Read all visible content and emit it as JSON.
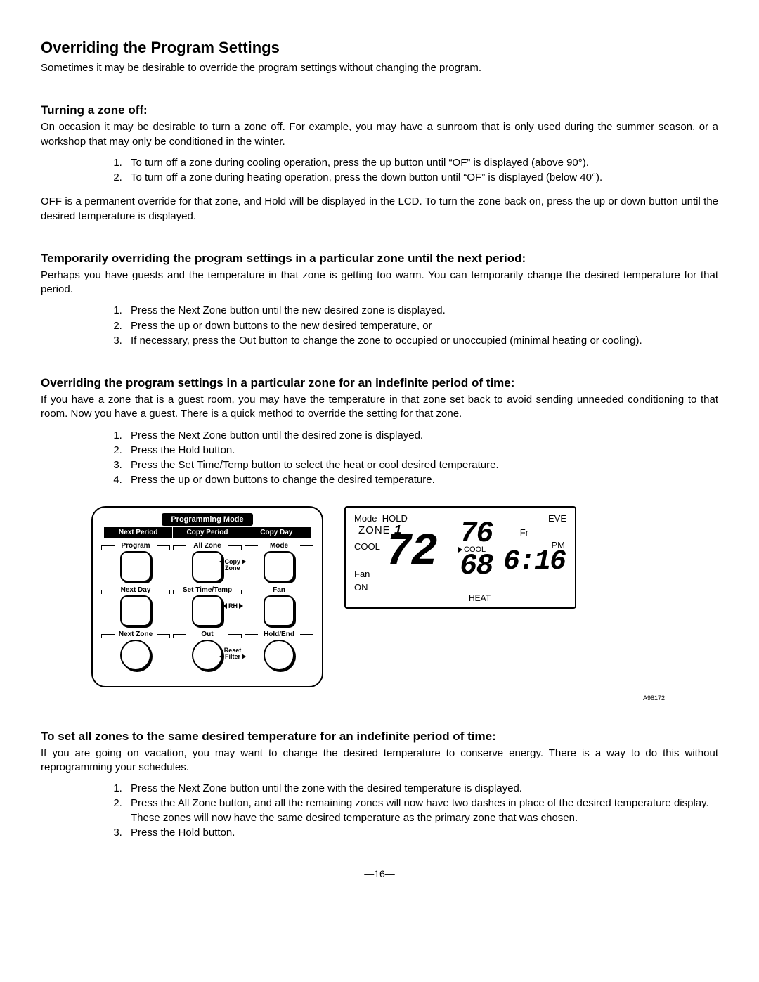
{
  "h1": "Overriding the Program Settings",
  "intro": "Sometimes it may be desirable to override the program settings without changing the program.",
  "s1": {
    "h": "Turning a zone off:",
    "p1": "On occasion it may be desirable to turn a zone off. For example, you may have a sunroom that is only used during the summer season, or a workshop that may only be conditioned in the winter.",
    "li1": "To turn off a zone during cooling operation, press the up button until “OF” is displayed (above 90°).",
    "li2": "To turn off a zone during heating operation, press the down button until “OF” is displayed (below 40°).",
    "p2": "OFF is a permanent override for that zone, and Hold will be displayed in the LCD. To turn the zone back on, press the up or down button until the desired temperature is displayed."
  },
  "s2": {
    "h": "Temporarily overriding the program settings in a particular zone until the next period:",
    "p": "Perhaps you have guests and the temperature in that zone is getting too warm. You can temporarily change the desired temperature for that period.",
    "li1": "Press the Next Zone button until the new desired zone is displayed.",
    "li2": "Press the up or down buttons to the new desired temperature, or",
    "li3": "If necessary, press the Out button to change the zone to occupied or unoccupied (minimal heating or cooling)."
  },
  "s3": {
    "h": "Overriding the program settings in a particular zone for an indefinite period of time:",
    "p": "If you have a zone that is a guest room, you may have the temperature in that zone set back to avoid sending unneeded conditioning to that room. Now you have a guest. There is a quick method to override the setting for that zone.",
    "li1": "Press the Next Zone button until the desired zone is displayed.",
    "li2": "Press the Hold button.",
    "li3": "Press the Set Time/Temp button to select the heat or cool desired temperature.",
    "li4": "Press the up or down buttons to change the desired temperature."
  },
  "panel": {
    "mode": "Programming Mode",
    "bar": {
      "a": "Next Period",
      "b": "Copy Period",
      "c": "Copy Day"
    },
    "r1": {
      "a": "Program",
      "b": "All Zone",
      "c": "Mode"
    },
    "r2": {
      "a": "Next Day",
      "b": "Set Time/Temp",
      "c": "Fan"
    },
    "r3": {
      "a": "Next Zone",
      "b": "Out",
      "c": "Hold/End"
    },
    "cz1": "Copy",
    "cz2": "Zone",
    "rh": "RH",
    "rf1": "Reset",
    "rf2": "Filter"
  },
  "lcd": {
    "mode": "Mode",
    "hold": "HOLD",
    "eve": "EVE",
    "zone": "ZONE",
    "zn": "1",
    "cool": "COOL",
    "fan": "Fan",
    "on": "ON",
    "t72": "72",
    "t76": "76",
    "t68": "68",
    "cool2": "COOL",
    "heat": "HEAT",
    "fr": "Fr",
    "pm": "PM",
    "time": "6:16"
  },
  "figid": "A98172",
  "s4": {
    "h": "To set all zones to the same desired temperature for an indefinite period of time:",
    "p": "If you are going on vacation, you may want to change the desired temperature to conserve energy. There is a way to do this without reprogramming your schedules.",
    "li1": "Press the Next Zone button until the zone with the desired temperature is displayed.",
    "li2": "Press the All Zone button, and all the remaining zones will now have two dashes in place of the desired temperature display. These zones will now have the same desired temperature as the primary zone that was chosen.",
    "li3": "Press the Hold button."
  },
  "page": "—16—"
}
